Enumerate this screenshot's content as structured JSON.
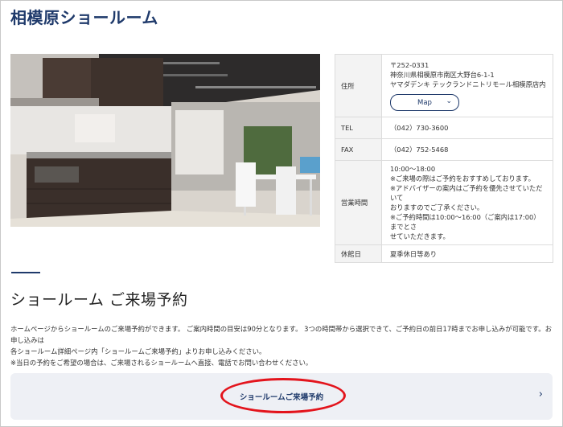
{
  "page": {
    "title": "相模原ショールーム"
  },
  "info": {
    "address_label": "住所",
    "address_lines": [
      "〒252-0331",
      "神奈川県相模原市南区大野台6-1-1",
      "ヤマダデンキ テックランドニトリモール相模原店内"
    ],
    "map_label": "Map",
    "tel_label": "TEL",
    "tel_value": "（042）730-3600",
    "fax_label": "FAX",
    "fax_value": "（042）752-5468",
    "hours_label": "営業時間",
    "hours_lines": [
      "10:00〜18:00",
      "※ご来場の際はご予約をおすすめしております。",
      "※アドバイザーの案内はご予約を優先させていただいて",
      "おりますのでご了承ください。",
      "※ご予約時間は10:00〜16:00（ご案内は17:00）までとさ",
      "せていただきます。"
    ],
    "closed_label": "休館日",
    "closed_value": "夏季休日等あり"
  },
  "reservation": {
    "title": "ショールーム ご来場予約",
    "desc_lines": [
      "ホームページからショールームのご来場予約ができます。 ご案内時間の目安は90分となります。 3つの時間帯から選択できて、ご予約日の前日17時までお申し込みが可能です。お申し込みは",
      "各ショールーム詳細ページ内「ショールームご来場予約」よりお申し込みください。",
      "※当日の予約をご希望の場合は、ご来場されるショールームへ直接、電話でお問い合わせください。"
    ],
    "button_label": "ショールームご来場予約",
    "highlight_color": "#e3141c"
  }
}
